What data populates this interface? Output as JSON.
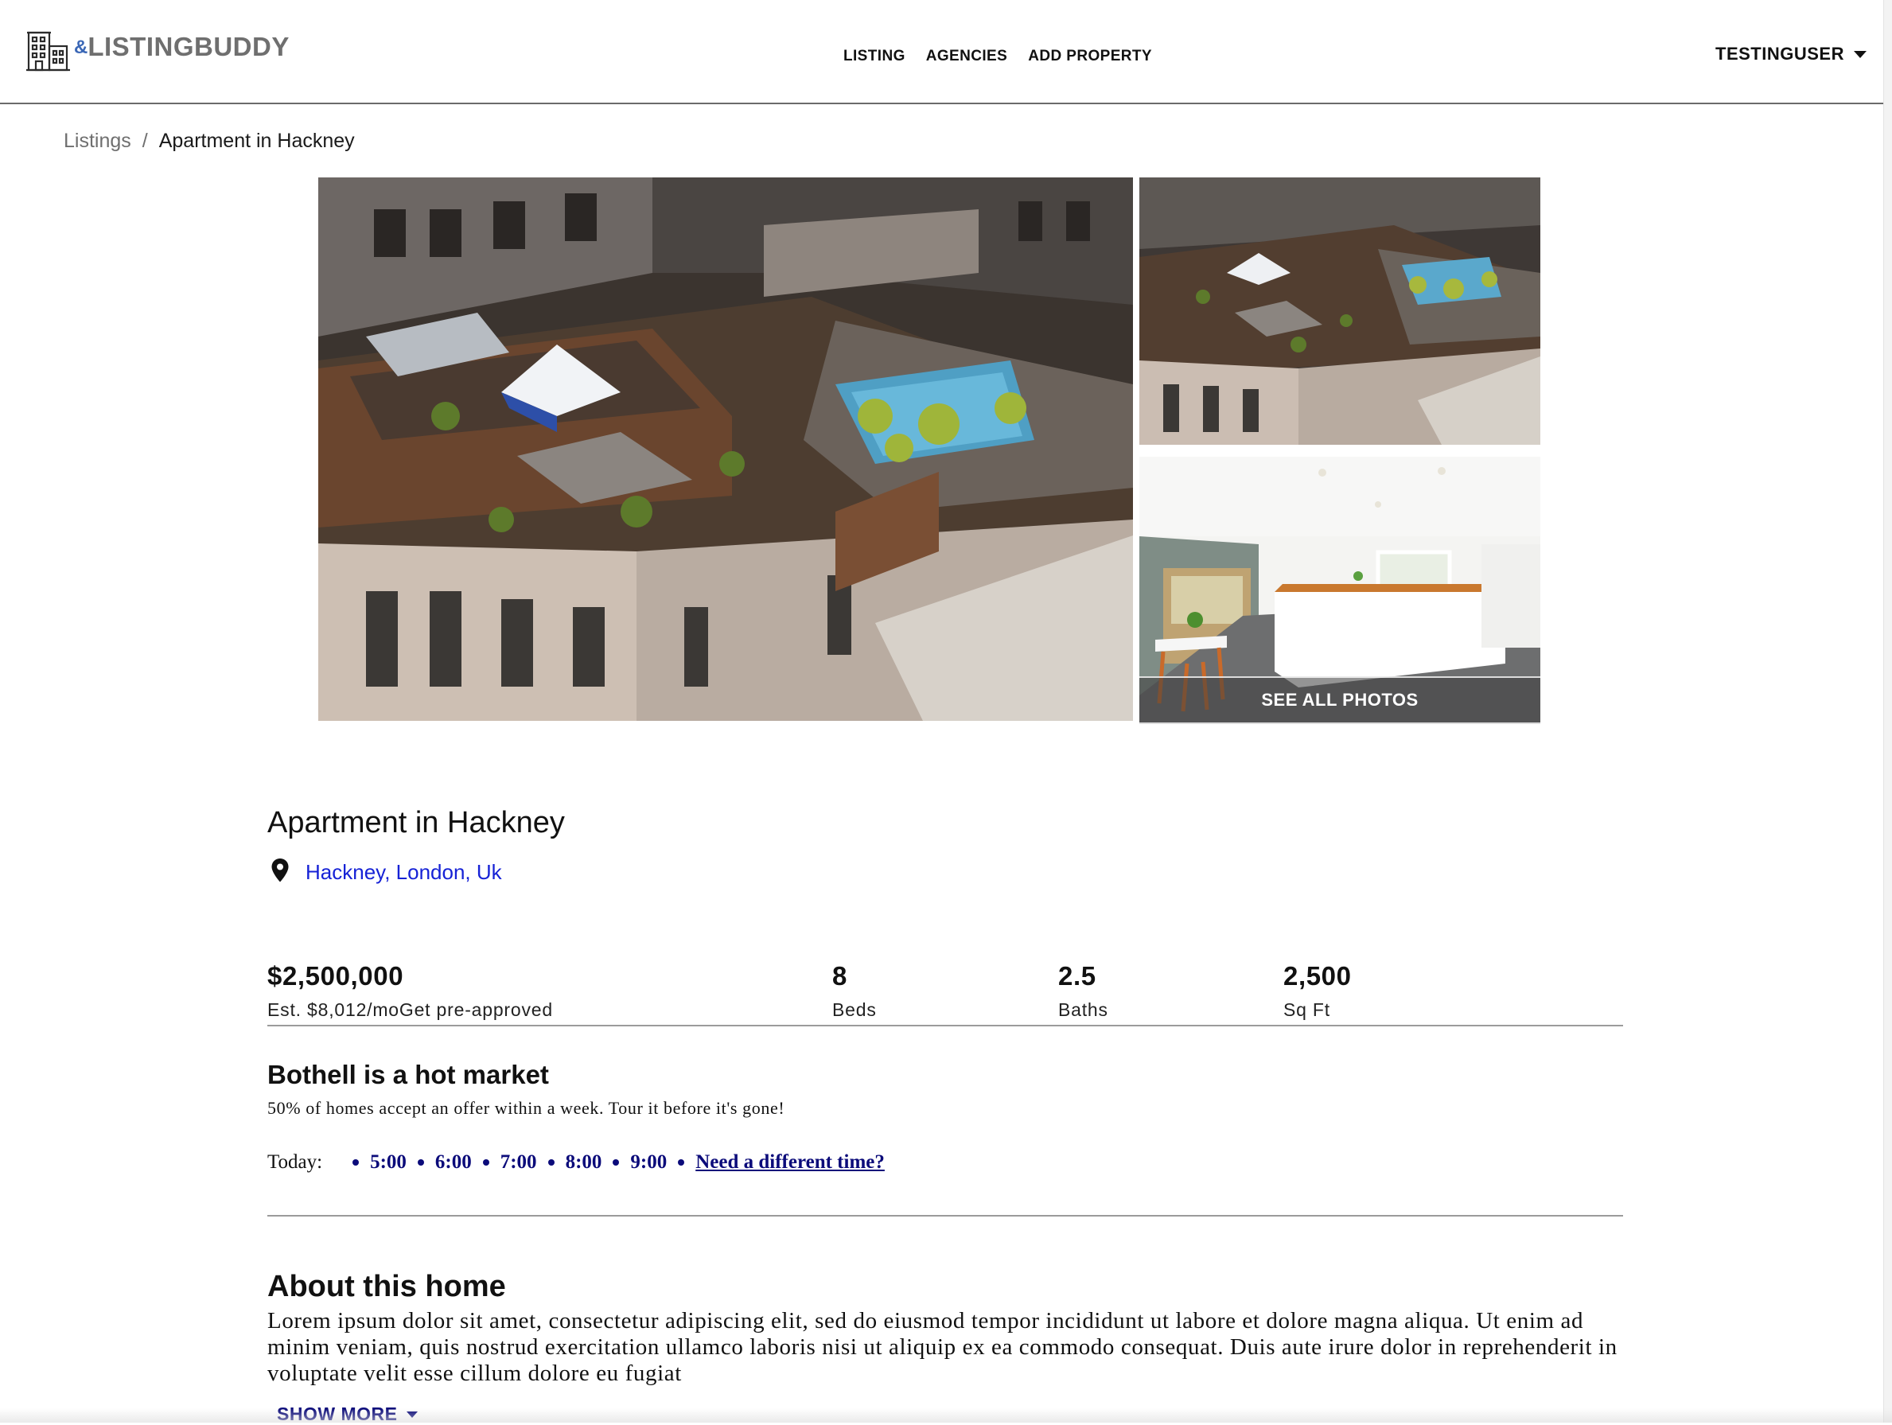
{
  "header": {
    "logo_amp": "&",
    "logo_text": "LISTINGBUDDY",
    "nav": [
      "LISTING",
      "AGENCIES",
      "ADD PROPERTY"
    ],
    "user": "TESTINGUSER"
  },
  "breadcrumb": {
    "parent": "Listings",
    "separator": "/",
    "current": "Apartment in Hackney"
  },
  "gallery": {
    "see_all_label": "SEE ALL PHOTOS"
  },
  "listing": {
    "title": "Apartment in Hackney",
    "location": "Hackney, London, Uk",
    "price": "$2,500,000",
    "price_note": "Est. $8,012/moGet pre-approved",
    "beds_value": "8",
    "beds_label": "Beds",
    "baths_value": "2.5",
    "baths_label": "Baths",
    "sqft_value": "2,500",
    "sqft_label": "Sq Ft"
  },
  "market": {
    "title": "Bothell is a hot market",
    "subtitle": "50% of homes accept an offer within a week. Tour it before it's gone!",
    "tour_label": "Today:",
    "slots": [
      "5:00",
      "6:00",
      "7:00",
      "8:00",
      "9:00"
    ],
    "different_time": "Need a different time?"
  },
  "about": {
    "title": "About this home",
    "body": "Lorem ipsum dolor sit amet, consectetur adipiscing elit, sed do eiusmod tempor incididunt ut labore et dolore magna aliqua. Ut enim ad minim veniam, quis nostrud exercitation ullamco laboris nisi ut aliquip ex ea commodo consequat. Duis aute irure dolor in reprehenderit in voluptate velit esse cillum dolore eu fugiat",
    "show_more": "SHOW MORE"
  },
  "colors": {
    "link_blue": "#1622d6",
    "navy": "#0b0b7a",
    "logo_blue": "#3a67b6",
    "logo_gray": "#6f6f6f"
  },
  "icons": [
    "building-logo-icon",
    "caret-down-icon",
    "map-pin-icon"
  ]
}
